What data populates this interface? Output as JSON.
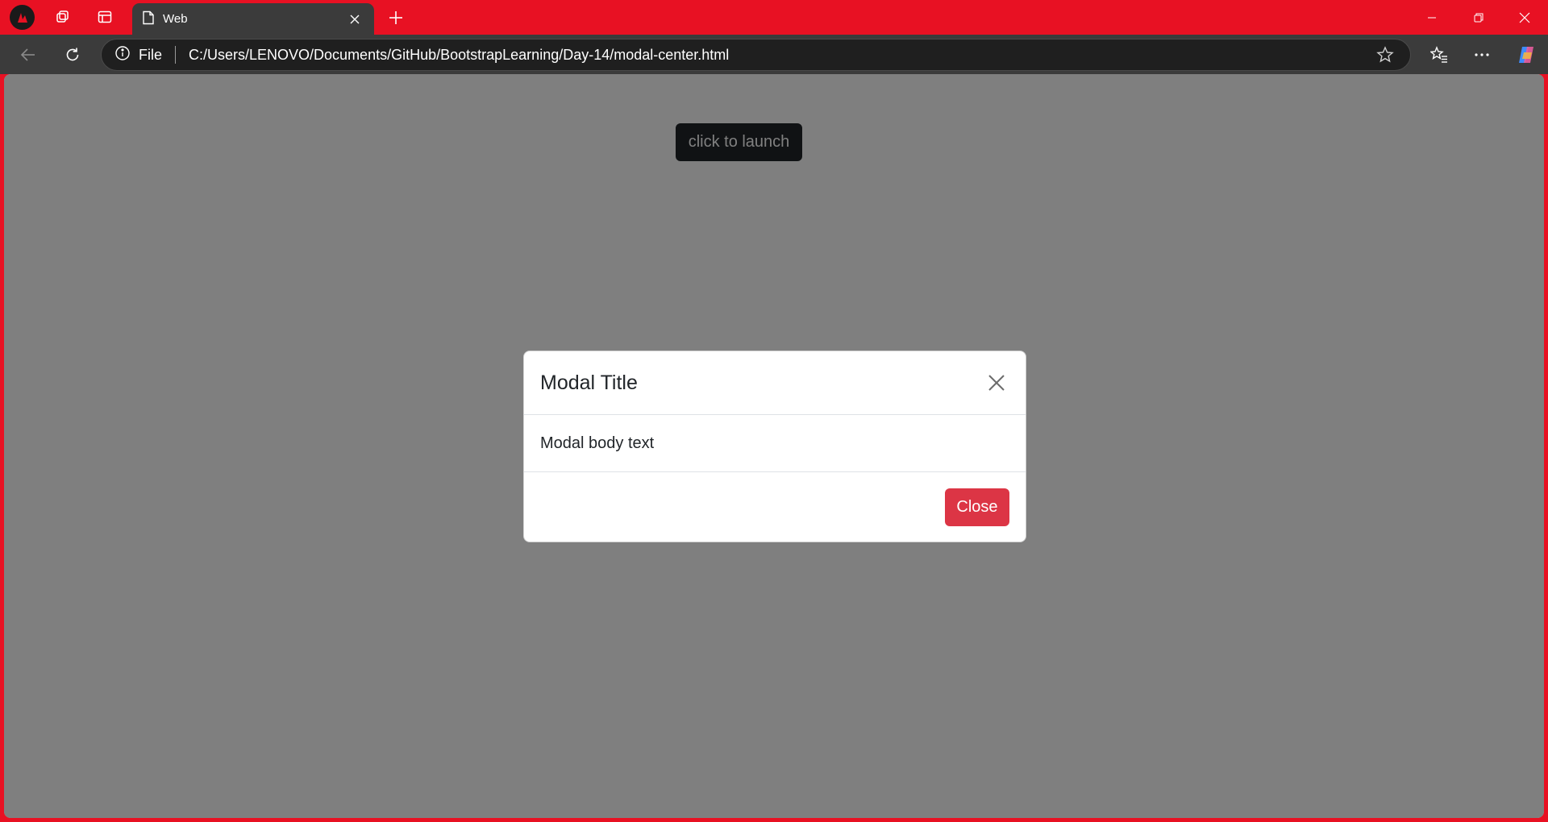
{
  "browser": {
    "tab": {
      "title": "Web"
    },
    "address": {
      "scheme_label": "File",
      "url": "C:/Users/LENOVO/Documents/GitHub/BootstrapLearning/Day-14/modal-center.html"
    }
  },
  "page": {
    "launch_button_label": "click to launch"
  },
  "modal": {
    "title": "Modal Title",
    "body": "Modal body text",
    "close_label": "Close"
  },
  "colors": {
    "titlebar": "#e81123",
    "toolbar": "#3b3b3b",
    "modal_close_button": "#dc3545",
    "launch_button": "#212529"
  },
  "icons": [
    "profile-icon",
    "collections-icon",
    "sidebar-icon",
    "page-icon",
    "tab-close-icon",
    "new-tab-icon",
    "minimize-icon",
    "restore-icon",
    "window-close-icon",
    "back-icon",
    "refresh-icon",
    "info-icon",
    "star-icon",
    "favorites-icon",
    "more-icon",
    "copilot-icon",
    "modal-close-icon"
  ]
}
